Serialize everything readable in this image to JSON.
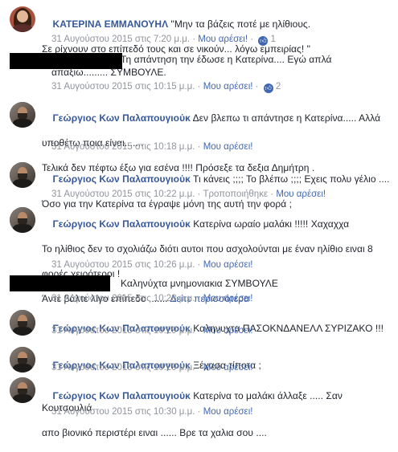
{
  "comments": [
    {
      "author": "ΚΑΤΕΡΙΝΑ ΕΜΜΑΝΟΥΗΛ",
      "text_l1": "\"Μην τα βάζεις ποτέ με ηλίθιους.",
      "text_l2": "Σε ρίχνουν στο επίπεδό τους και σε νικούν... λόγω εμπειρίας! \"",
      "timestamp": "31 Αυγούστου 2015 στις 7:20 μ.μ.",
      "like_label": "Μου αρέσει!",
      "like_count": "1"
    },
    {
      "text_l1": "Τη απάντηση την έδωσε η Κατερίνα.... Εγώ απλά",
      "text_l2": "απαξιω......... ΣΥΜΒΟΥΛΕ.",
      "timestamp": "31 Αυγούστου 2015 στις 10:15 μ.μ.",
      "like_label": "Μου αρέσει!",
      "like_count": "2"
    },
    {
      "author": "Γεώργιος Κων Παλαπουγιούκ",
      "text_l1": "Δεν βλεπω τι απάντησε η Κατερίνα..... Αλλά",
      "text_l2": "υποθέτω ποια είναι.......",
      "text_l3": "Τελικά δεν πέφτω έξω για εσένα !!!! Πρόσεξε τα δεξια Δημήτρη .",
      "timestamp": "31 Αυγούστου 2015 στις 10:18 μ.μ.",
      "like_label": "Μου αρέσει!"
    },
    {
      "author": "Γεώργιος Κων Παλαπουγιούκ",
      "text_l1": "Τι κάνεις ;;;; Το βλέπω ;;;; Εχεις πολυ γέλιο ....",
      "text_l2": "Όσο για την Κατερίνα τα έγραψε μόνη της αυτή την φορά ;",
      "timestamp": "31 Αυγούστου 2015 στις 10:22 μ.μ.",
      "edited_label": "Τροποποιήθηκε",
      "like_label": "Μου αρέσει!"
    },
    {
      "author": "Γεώργιος Κων Παλαπουγιούκ",
      "text_l1": "Κατερίνα ωραίο μαλάκι !!!!! Χαχαχχα",
      "text_l2": "Το ηλίθιος δεν το σχολιάζω διότι αυτοι που ασχολούνται με έναν ηλίθιο ειναι 8",
      "text_l3": "φορές χειρότεροι !",
      "text_l4": "Άντε βάλτε λίγο επίπεδο .......",
      "see_more": "Δείτε περισσότερα",
      "timestamp": "31 Αυγούστου 2015 στις 10:26 μ.μ.",
      "like_label": "Μου αρέσει!"
    },
    {
      "text_l1": "Καληνύχτα μνημονιακια ΣΥΜΒΟΥΛΕ",
      "timestamp": "31 Αυγούστου 2015 στις 10:28 μ.μ.",
      "like_label": "Μου αρέσει!"
    },
    {
      "author": "Γεώργιος Κων Παλαπουγιούκ",
      "text_l1": "Καληνυχτα ΠΑΣΟΚΝΔΑΝΕΛΛ ΣΥΡΙΖΑΚΟ !!!",
      "timestamp": "31 Αυγούστου 2015 στις 10:29 μ.μ.",
      "like_label": "Μου αρέσει!"
    },
    {
      "author": "Γεώργιος Κων Παλαπουγιούκ",
      "text_l1": "Ξέχασα τίποτα ;",
      "timestamp": "31 Αυγούστου 2015 στις 10:29 μ.μ.",
      "like_label": "Μου αρέσει!"
    },
    {
      "author": "Γεώργιος Κων Παλαπουγιούκ",
      "text_l1": "Κατερίνα το μαλάκι άλλαξε ..... Σαν Κουτσουλιά",
      "text_l2": "απο βιονικό περιστέρι ειναι ...... Βρε τα χαλια σου ....",
      "timestamp": "31 Αυγούστου 2015 στις 10:30 μ.μ.",
      "like_label": "Μου αρέσει!"
    }
  ],
  "separator": "·"
}
